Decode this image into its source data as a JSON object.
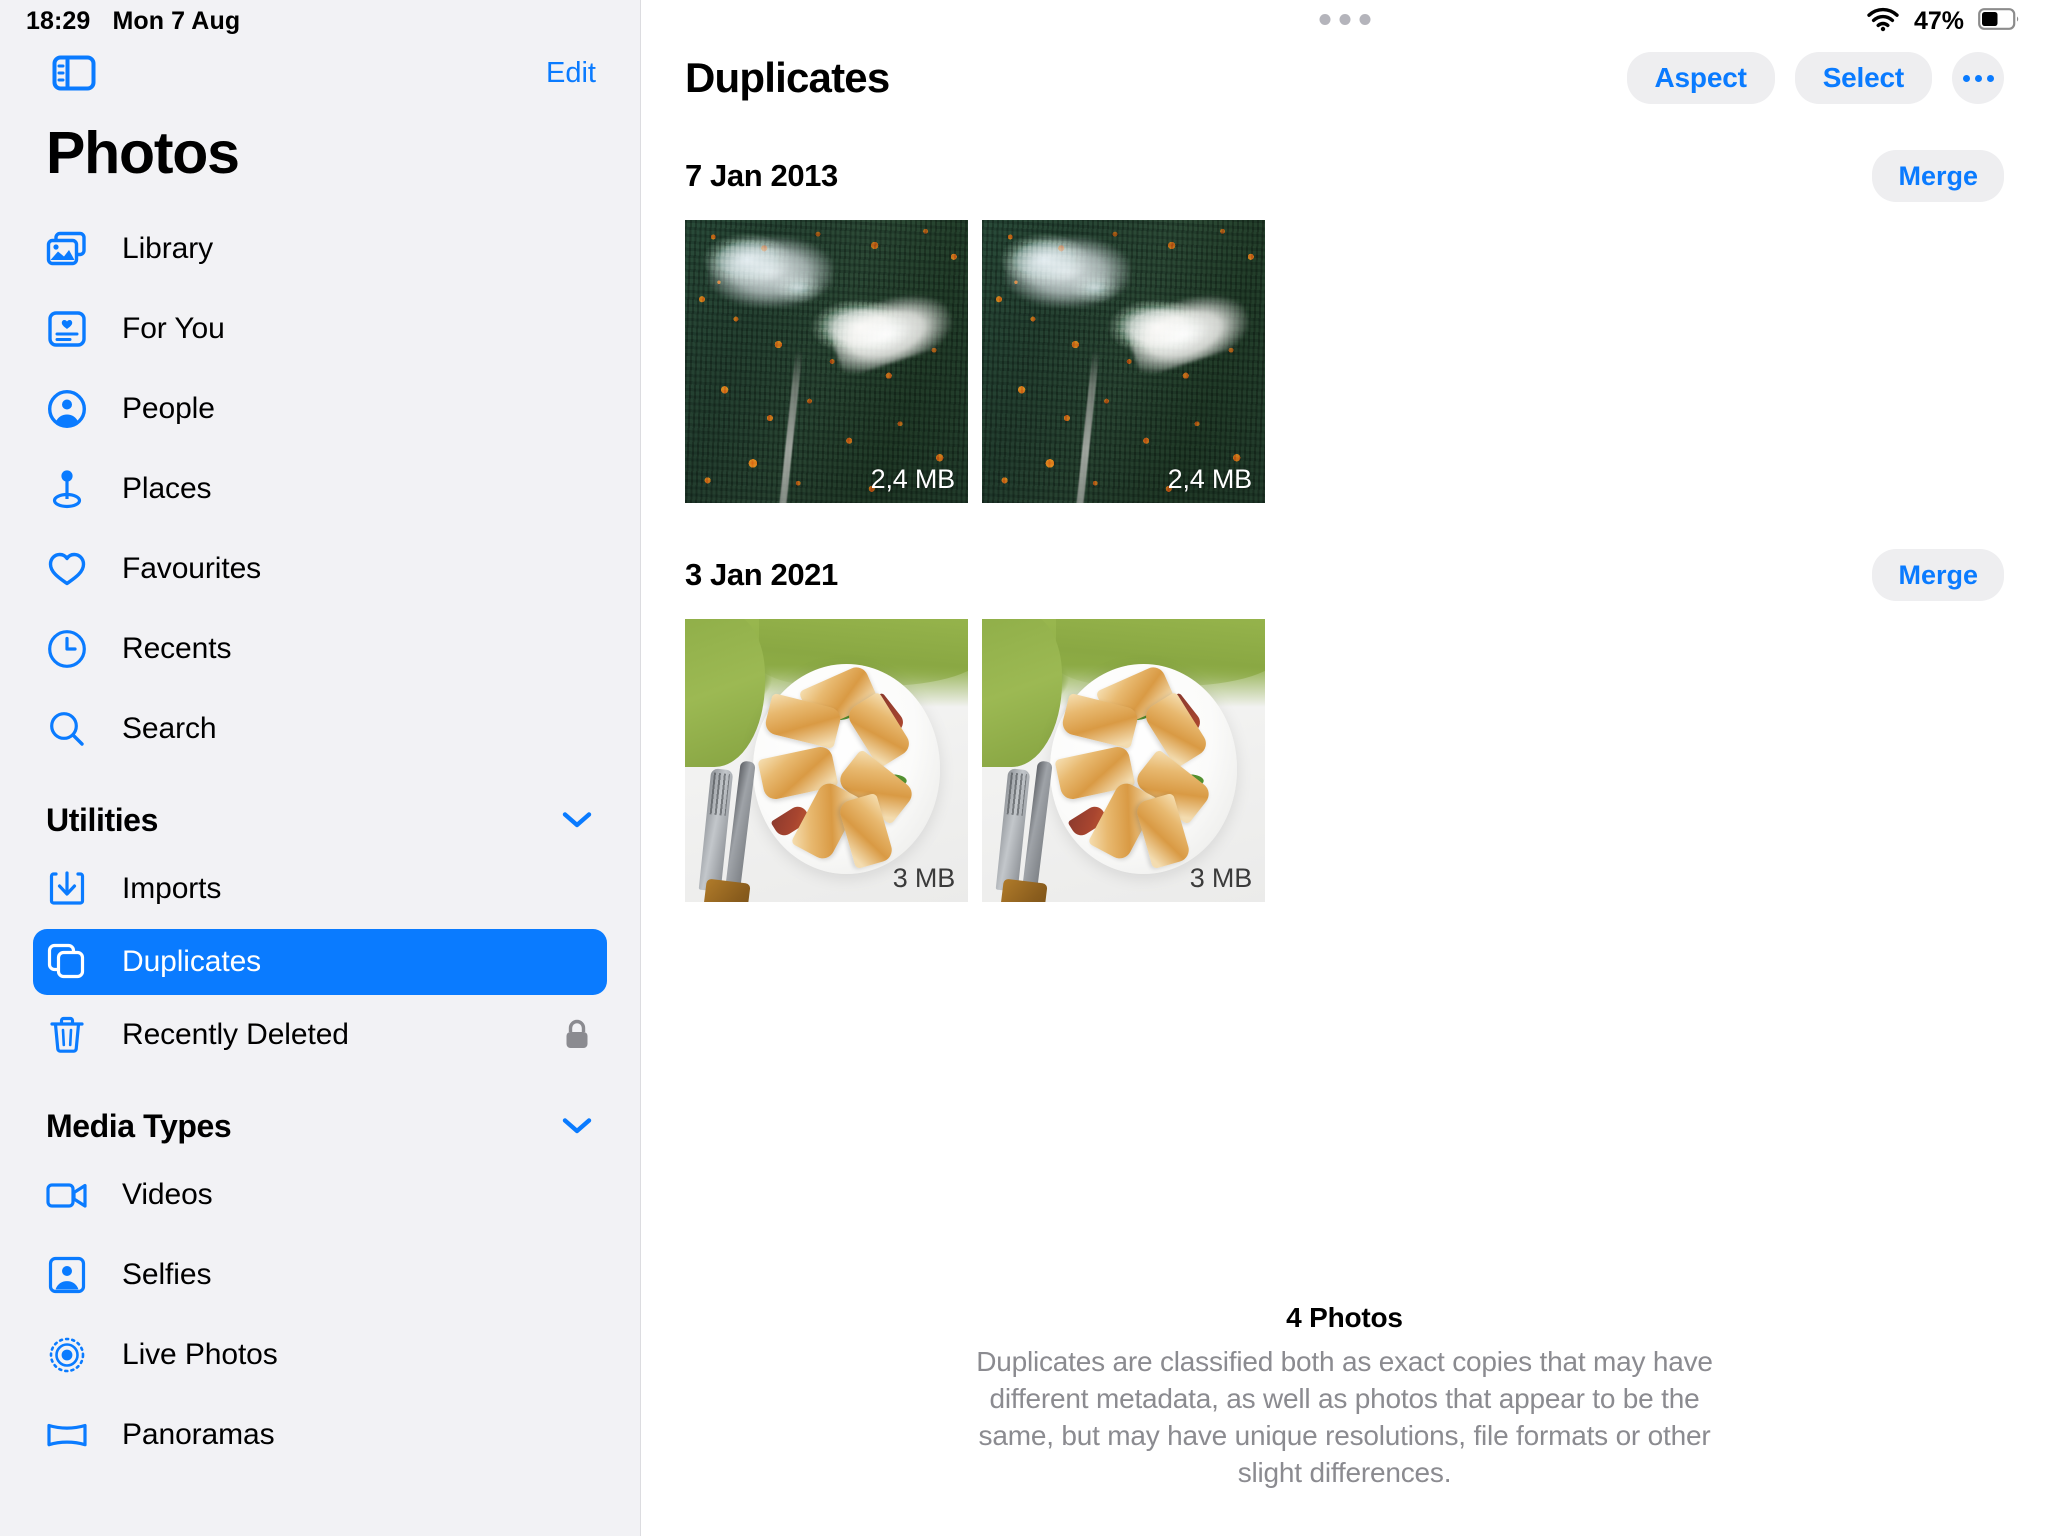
{
  "status_bar": {
    "time": "18:29",
    "date": "Mon 7 Aug",
    "battery_percent": "47%",
    "wifi_icon": "wifi-icon",
    "battery_icon": "battery-icon"
  },
  "sidebar": {
    "toggle_icon": "sidebar-toggle-icon",
    "edit_label": "Edit",
    "title": "Photos",
    "primary_items": [
      {
        "label": "Library",
        "icon": "photo-stack-icon",
        "selected": false
      },
      {
        "label": "For You",
        "icon": "for-you-card-icon",
        "selected": false
      },
      {
        "label": "People",
        "icon": "person-circle-icon",
        "selected": false
      },
      {
        "label": "Places",
        "icon": "map-pin-icon",
        "selected": false
      },
      {
        "label": "Favourites",
        "icon": "heart-icon",
        "selected": false
      },
      {
        "label": "Recents",
        "icon": "clock-icon",
        "selected": false
      },
      {
        "label": "Search",
        "icon": "search-icon",
        "selected": false
      }
    ],
    "sections": [
      {
        "title": "Utilities",
        "chevron_icon": "chevron-down-icon",
        "items": [
          {
            "label": "Imports",
            "icon": "import-tray-icon",
            "selected": false,
            "trailing_icon": null
          },
          {
            "label": "Duplicates",
            "icon": "duplicate-squares-icon",
            "selected": true,
            "trailing_icon": null
          },
          {
            "label": "Recently Deleted",
            "icon": "trash-icon",
            "selected": false,
            "trailing_icon": "lock-icon"
          }
        ]
      },
      {
        "title": "Media Types",
        "chevron_icon": "chevron-down-icon",
        "items": [
          {
            "label": "Videos",
            "icon": "video-camera-icon",
            "selected": false,
            "trailing_icon": null
          },
          {
            "label": "Selfies",
            "icon": "selfie-person-icon",
            "selected": false,
            "trailing_icon": null
          },
          {
            "label": "Live Photos",
            "icon": "live-photo-icon",
            "selected": false,
            "trailing_icon": null
          },
          {
            "label": "Panoramas",
            "icon": "panorama-icon",
            "selected": false,
            "trailing_icon": null
          }
        ]
      }
    ]
  },
  "main": {
    "grabber_icon": "window-grabber-icon",
    "title": "Duplicates",
    "actions": {
      "aspect_label": "Aspect",
      "select_label": "Select",
      "more_icon": "ellipsis-icon"
    },
    "groups": [
      {
        "date": "7 Jan 2013",
        "merge_label": "Merge",
        "art": "forest",
        "photos": [
          {
            "size": "2,4 MB"
          },
          {
            "size": "2,4 MB"
          }
        ]
      },
      {
        "date": "3 Jan 2021",
        "merge_label": "Merge",
        "art": "food",
        "photos": [
          {
            "size": "3 MB"
          },
          {
            "size": "3 MB"
          }
        ]
      }
    ],
    "footer": {
      "count": "4 Photos",
      "description": "Duplicates are classified both as exact copies that may have different metadata, as well as photos that appear to be the same, but may have unique resolutions, file formats or other slight differences."
    }
  },
  "colors": {
    "accent_blue": "#0a7bff",
    "sidebar_bg": "#f2f2f5",
    "pill_bg": "#eeeef0",
    "footer_text": "#8b8b90"
  }
}
